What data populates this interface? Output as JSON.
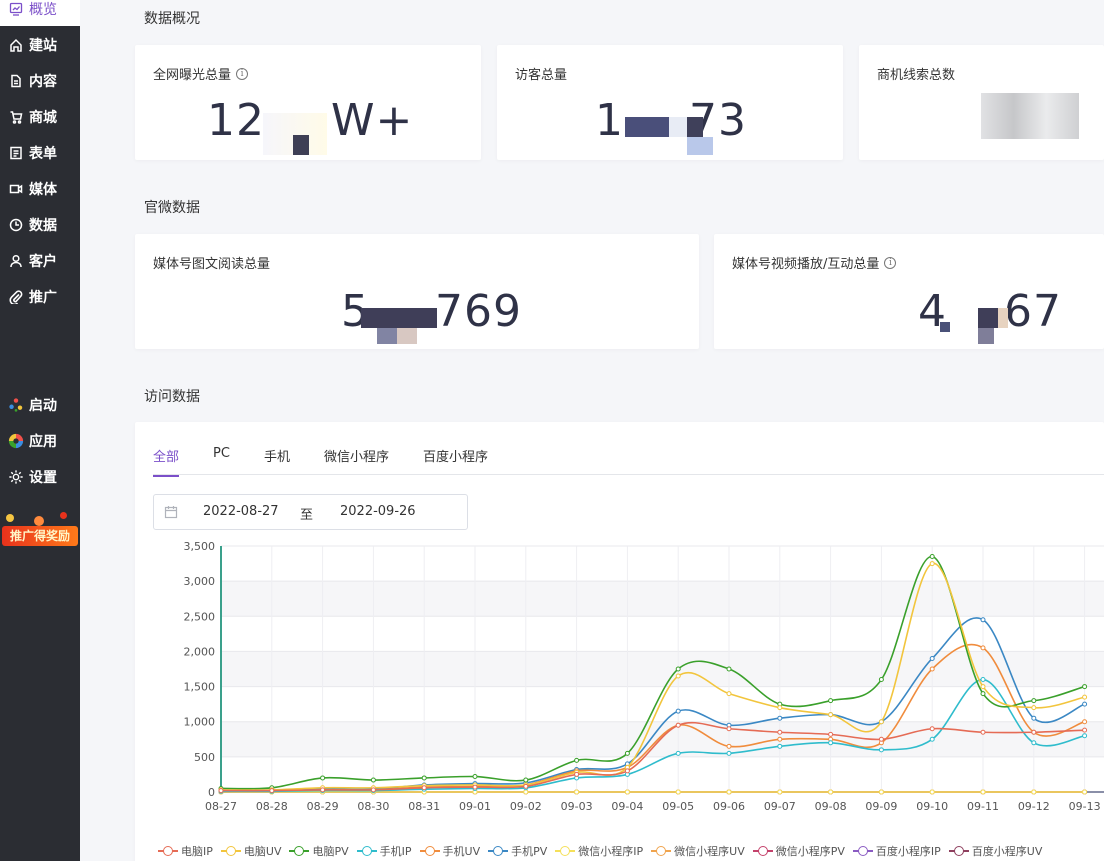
{
  "sidebar": {
    "items": [
      {
        "label": "概览",
        "icon": "chart-icon"
      },
      {
        "label": "建站",
        "icon": "home-icon"
      },
      {
        "label": "内容",
        "icon": "document-icon"
      },
      {
        "label": "商城",
        "icon": "cart-icon"
      },
      {
        "label": "表单",
        "icon": "form-icon"
      },
      {
        "label": "媒体",
        "icon": "video-icon"
      },
      {
        "label": "数据",
        "icon": "pie-icon"
      },
      {
        "label": "客户",
        "icon": "user-icon"
      },
      {
        "label": "推广",
        "icon": "paperclip-icon"
      }
    ],
    "bottom_items": [
      {
        "label": "启动",
        "icon": "launch-icon"
      },
      {
        "label": "应用",
        "icon": "apps-icon"
      },
      {
        "label": "设置",
        "icon": "gear-icon"
      }
    ],
    "promo_label": "推广得奖励"
  },
  "overview": {
    "title": "数据概况",
    "cards": [
      {
        "label": "全网曝光总量",
        "value_left": "12",
        "value_right": "W+"
      },
      {
        "label": "访客总量",
        "value_left": "1",
        "value_right": "73"
      },
      {
        "label": "商机线索总数",
        "value_left": "",
        "value_right": ""
      }
    ]
  },
  "official": {
    "title": "官微数据",
    "cards": [
      {
        "label": "媒体号图文阅读总量",
        "value_left": "5",
        "value_right": "769"
      },
      {
        "label": "媒体号视频播放/互动总量",
        "value_left": "4",
        "value_right": "67"
      }
    ]
  },
  "visits": {
    "title": "访问数据",
    "tabs": [
      "全部",
      "PC",
      "手机",
      "微信小程序",
      "百度小程序"
    ],
    "date_start": "2022-08-27",
    "date_sep": "至",
    "date_end": "2022-09-26"
  },
  "chart_data": {
    "type": "line",
    "x": [
      "08-27",
      "08-28",
      "08-29",
      "08-30",
      "08-31",
      "09-01",
      "09-02",
      "09-03",
      "09-04",
      "09-05",
      "09-06",
      "09-07",
      "09-08",
      "09-09",
      "09-10",
      "09-11",
      "09-12",
      "09-13"
    ],
    "yticks": [
      "0",
      "500",
      "1,000",
      "1,500",
      "2,000",
      "2,500",
      "3,000",
      "3,500"
    ],
    "ylim": [
      0,
      3500
    ],
    "series": [
      {
        "name": "电脑IP",
        "color": "#e56b55",
        "values": [
          20,
          20,
          30,
          30,
          60,
          70,
          80,
          250,
          300,
          950,
          900,
          850,
          820,
          750,
          900,
          850,
          850,
          880
        ]
      },
      {
        "name": "电脑UV",
        "color": "#f2c53d",
        "values": [
          30,
          30,
          60,
          60,
          90,
          100,
          100,
          280,
          350,
          1650,
          1400,
          1200,
          1100,
          1000,
          3250,
          1500,
          1200,
          1350
        ]
      },
      {
        "name": "电脑PV",
        "color": "#3aa02b",
        "values": [
          50,
          60,
          200,
          170,
          200,
          220,
          170,
          450,
          550,
          1750,
          1750,
          1250,
          1300,
          1600,
          3350,
          1400,
          1300,
          1500
        ]
      },
      {
        "name": "手机IP",
        "color": "#2fbccc",
        "values": [
          10,
          10,
          20,
          20,
          40,
          50,
          60,
          200,
          250,
          550,
          550,
          650,
          700,
          600,
          750,
          1600,
          700,
          800
        ]
      },
      {
        "name": "手机UV",
        "color": "#f08c3d",
        "values": [
          10,
          15,
          30,
          30,
          70,
          80,
          100,
          300,
          350,
          950,
          650,
          750,
          750,
          700,
          1750,
          2050,
          850,
          1000
        ]
      },
      {
        "name": "手机PV",
        "color": "#3b88c4",
        "values": [
          15,
          20,
          40,
          40,
          100,
          120,
          130,
          320,
          400,
          1150,
          950,
          1050,
          1100,
          1000,
          1900,
          2450,
          1050,
          1250
        ]
      },
      {
        "name": "微信小程序IP",
        "color": "#f5e05a",
        "values": [
          0,
          0,
          0,
          0,
          0,
          0,
          0,
          0,
          0,
          0,
          0,
          0,
          0,
          0,
          0,
          0,
          0,
          0
        ]
      },
      {
        "name": "微信小程序UV",
        "color": "#f0a44e",
        "values": [
          0,
          0,
          0,
          0,
          0,
          0,
          0,
          0,
          0,
          0,
          0,
          0,
          0,
          0,
          0,
          0,
          0,
          0
        ]
      },
      {
        "name": "微信小程序PV",
        "color": "#c4416b",
        "values": [
          0,
          0,
          0,
          0,
          0,
          0,
          0,
          0,
          0,
          0,
          0,
          0,
          0,
          0,
          0,
          0,
          0,
          0
        ]
      },
      {
        "name": "百度小程序IP",
        "color": "#8a5bc2",
        "values": [
          0,
          0,
          0,
          0,
          0,
          0,
          0,
          0,
          0,
          0,
          0,
          0,
          0,
          0,
          0,
          0,
          0,
          0
        ]
      },
      {
        "name": "百度小程序UV",
        "color": "#8e3f5e",
        "values": [
          0,
          0,
          0,
          0,
          0,
          0,
          0,
          0,
          0,
          0,
          0,
          0,
          0,
          0,
          0,
          0,
          0,
          0
        ]
      }
    ],
    "legend_placement": "bottom",
    "grid": true
  }
}
